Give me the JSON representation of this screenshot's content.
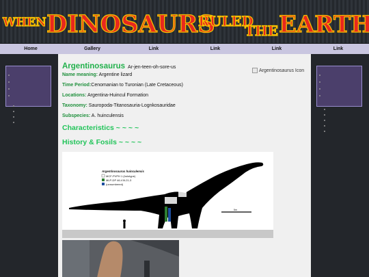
{
  "banner": {
    "word1": "WHEN",
    "word2": "DINOSAURS",
    "word3": "RULED",
    "word4": "THE",
    "word5": "EARTH"
  },
  "nav": {
    "items": [
      "Home",
      "Gallery",
      "Link",
      "Link",
      "Link",
      "Link"
    ]
  },
  "article": {
    "name": "Argentinosaurus",
    "pronunciation": "Ar-jen-teen-oh-sore-us",
    "icon_alt": "Argentinosaurus Icon",
    "fields": [
      {
        "label": "Name meaning:",
        "value": " Argentine lizard"
      },
      {
        "label": "Time Period:",
        "value": "Cenomanian to Turonian (Late Cretaceous)"
      },
      {
        "label": "Locations:",
        "value": " Argentina-Huincul Formation"
      },
      {
        "label": "Taxonomy:",
        "value": " Sauropoda-Titanosauria-Lognkosauridae"
      },
      {
        "label": "Subspecies:",
        "value": " A. huinculensis"
      }
    ],
    "section1": "Characteristics ~ ~ ~ ~",
    "section2": "History & Fosils ~ ~ ~ ~"
  },
  "figure": {
    "caption_title": "Argentinosaurus huinculensis",
    "legend": [
      "MCF-PVPH 1 (holotype)",
      "MLP-DP 46-VIII-21-3",
      "(unnumbered)"
    ],
    "legend_colors": [
      "#ffffff",
      "#2e7d32",
      "#1e4fa0"
    ],
    "scale_label": "5m"
  }
}
